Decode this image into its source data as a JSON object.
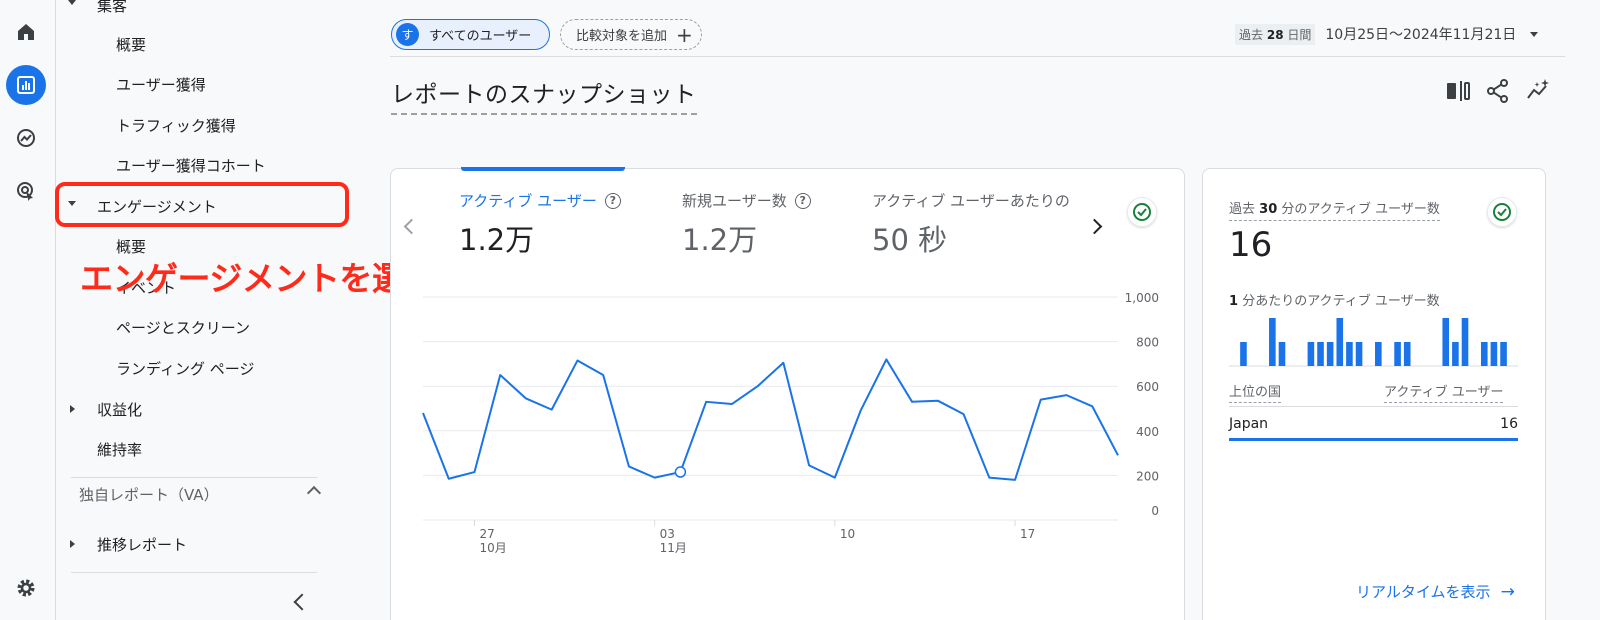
{
  "nav": {
    "section_acquisition": "集客",
    "acq_overview": "概要",
    "acq_user": "ユーザー獲得",
    "acq_traffic": "トラフィック獲得",
    "acq_cohort": "ユーザー獲得コホート",
    "engagement": "エンゲージメント",
    "eng_overview": "概要",
    "eng_events": "イベント",
    "eng_pages": "ページとスクリーン",
    "eng_landing": "ランディング ページ",
    "monetization": "収益化",
    "retention": "維持率",
    "custom_section": "独自レポート（VA）",
    "trend_report": "推移レポート"
  },
  "annotation": "エンゲージメントを選択",
  "topbar": {
    "segment_avatar": "す",
    "segment_label": "すべてのユーザー",
    "add_comparison": "比較対象を追加",
    "date_badge_prefix": "過去",
    "date_badge_num": "28",
    "date_badge_suffix": "日間",
    "date_range": "10月25日～2024年11月21日"
  },
  "page_title": "レポートのスナップショット",
  "metrics": [
    {
      "label": "アクティブ ユーザー",
      "value": "1.2万"
    },
    {
      "label": "新規ユーザー数",
      "value": "1.2万"
    },
    {
      "label": "アクティブ ユーザーあたりの",
      "value": "50 秒"
    }
  ],
  "chart_data": {
    "type": "line",
    "series": [
      {
        "values": [
          480,
          185,
          215,
          650,
          545,
          495,
          715,
          650,
          240,
          190,
          215,
          530,
          520,
          600,
          705,
          245,
          190,
          490,
          720,
          530,
          535,
          475,
          190,
          180,
          540,
          560,
          510,
          290
        ]
      }
    ],
    "x_tick_labels": [
      {
        "index": 2,
        "label": "27",
        "sub": "10月"
      },
      {
        "index": 9,
        "label": "03",
        "sub": "11月"
      },
      {
        "index": 16,
        "label": "10",
        "sub": ""
      },
      {
        "index": 23,
        "label": "17",
        "sub": ""
      }
    ],
    "y_ticks": [
      0,
      200,
      400,
      600,
      800,
      1000
    ],
    "y_tick_labels": [
      "0",
      "200",
      "400",
      "600",
      "800",
      "1,000"
    ],
    "ylim": [
      0,
      1000
    ],
    "highlight_index": 10,
    "color": "#1a73e8",
    "grid": true
  },
  "realtime": {
    "title_prefix": "過去",
    "title_num": "30",
    "title_suffix": "分のアクティブ ユーザー数",
    "value": "16",
    "sub_prefix": "1",
    "sub_suffix": "分あたりのアクティブ ユーザー数",
    "bars": [
      0,
      2,
      0,
      0,
      4,
      2,
      0,
      0,
      2,
      2,
      2,
      4,
      2,
      2,
      0,
      2,
      0,
      2,
      2,
      0,
      0,
      0,
      4,
      2,
      4,
      0,
      2,
      2,
      2,
      0
    ],
    "bar_max": 4,
    "col_country": "上位の国",
    "col_users": "アクティブ ユーザー",
    "rows": [
      {
        "country": "Japan",
        "users": "16"
      }
    ],
    "link": "リアルタイムを表示"
  },
  "colors": {
    "accent": "#1a73e8",
    "annotation": "#ff2a1a",
    "check": "#188038"
  }
}
